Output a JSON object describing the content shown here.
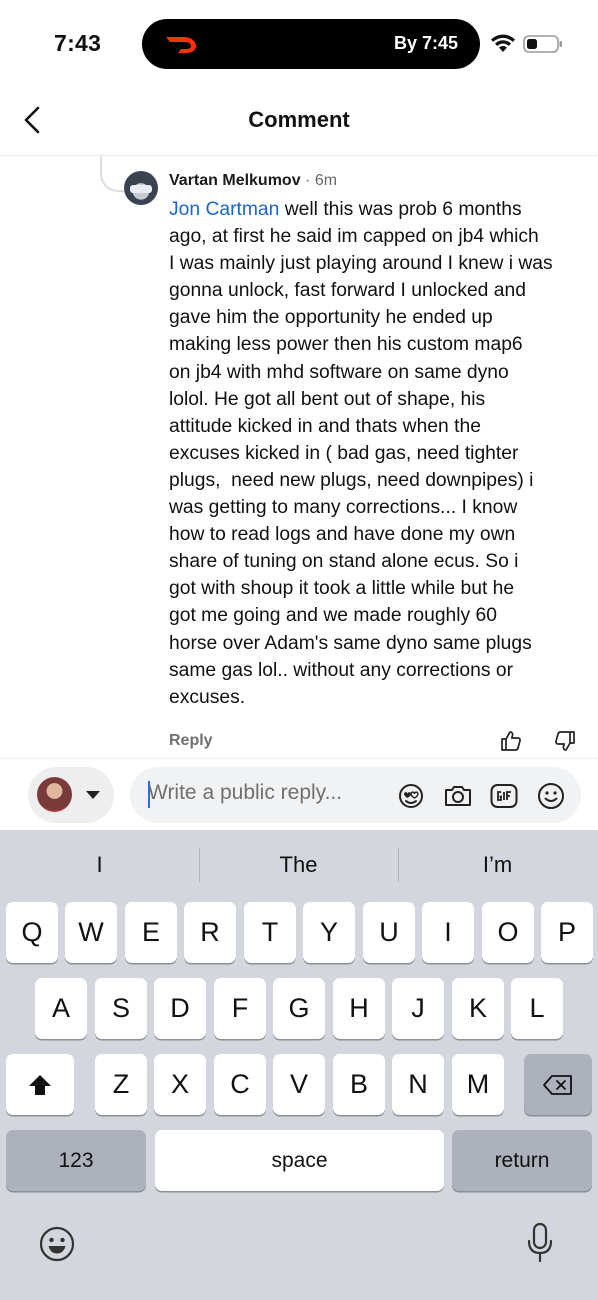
{
  "status": {
    "time": "7:43",
    "live_activity_eta": "By 7:45",
    "brand_color": "#ff3008"
  },
  "nav": {
    "title": "Comment"
  },
  "comment": {
    "author": "Vartan Melkumov",
    "meta": " · 6m",
    "mention": "Jon Cartman",
    "lines": [
      " well this was prob 6 months",
      "ago, at first he said im capped on jb4 which",
      "I was mainly just playing around I knew i was",
      "gonna unlock, fast forward I unlocked and",
      "gave him the opportunity he ended up",
      "making less power then his custom map6",
      "on jb4 with mhd software on same dyno",
      "lolol. He got all bent out of shape, his",
      "attitude kicked in and thats when the",
      "excuses kicked in ( bad gas, need tighter",
      "plugs,  need new plugs, need downpipes) i",
      "was getting to many corrections... I know",
      "how to read logs and have done my own",
      "share of tuning on stand alone ecus. So i",
      "got with shoup it took a little while but he",
      "got me going and we made roughly 60",
      "horse over Adam's same dyno same plugs",
      "same gas lol.. without any corrections or",
      "excuses."
    ],
    "reply_label": "Reply",
    "mention_color": "#1a66c7"
  },
  "reply_bar": {
    "placeholder": "Write a public reply..."
  },
  "keyboard": {
    "suggestions": [
      "I",
      "The",
      "I’m"
    ],
    "row1": [
      "Q",
      "W",
      "E",
      "R",
      "T",
      "Y",
      "U",
      "I",
      "O",
      "P"
    ],
    "row2": [
      "A",
      "S",
      "D",
      "F",
      "G",
      "H",
      "J",
      "K",
      "L"
    ],
    "row3": [
      "Z",
      "X",
      "C",
      "V",
      "B",
      "N",
      "M"
    ],
    "numbers_label": "123",
    "space_label": "space",
    "return_label": "return"
  }
}
